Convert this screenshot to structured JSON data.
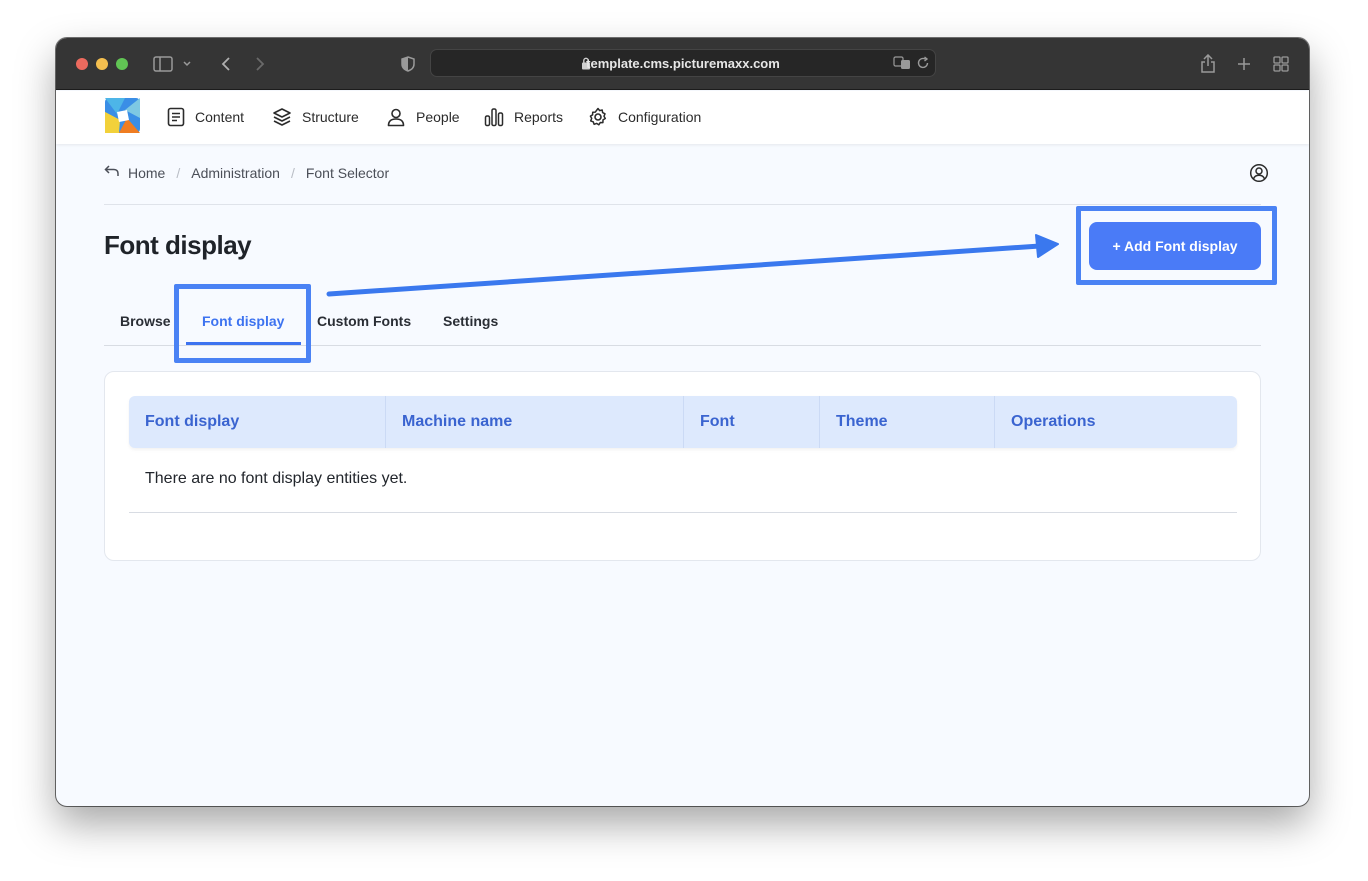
{
  "browser": {
    "url": "template.cms.picturemaxx.com"
  },
  "nav": {
    "items": [
      {
        "label": "Content",
        "icon": "document-icon"
      },
      {
        "label": "Structure",
        "icon": "layers-icon"
      },
      {
        "label": "People",
        "icon": "person-icon"
      },
      {
        "label": "Reports",
        "icon": "bar-chart-icon"
      },
      {
        "label": "Configuration",
        "icon": "gear-icon"
      }
    ]
  },
  "breadcrumb": {
    "items": [
      "Home",
      "Administration",
      "Font Selector"
    ]
  },
  "page": {
    "title": "Font display",
    "add_button": "+ Add Font display"
  },
  "tabs": [
    {
      "label": "Browse",
      "active": false
    },
    {
      "label": "Font display",
      "active": true
    },
    {
      "label": "Custom Fonts",
      "active": false
    },
    {
      "label": "Settings",
      "active": false
    }
  ],
  "table": {
    "columns": [
      "Font display",
      "Machine name",
      "Font",
      "Theme",
      "Operations"
    ],
    "empty_message": "There are no font display entities yet."
  },
  "colors": {
    "accent": "#4a7bf7",
    "annotation": "#4a82f4",
    "header_bg": "#dde9fd"
  }
}
